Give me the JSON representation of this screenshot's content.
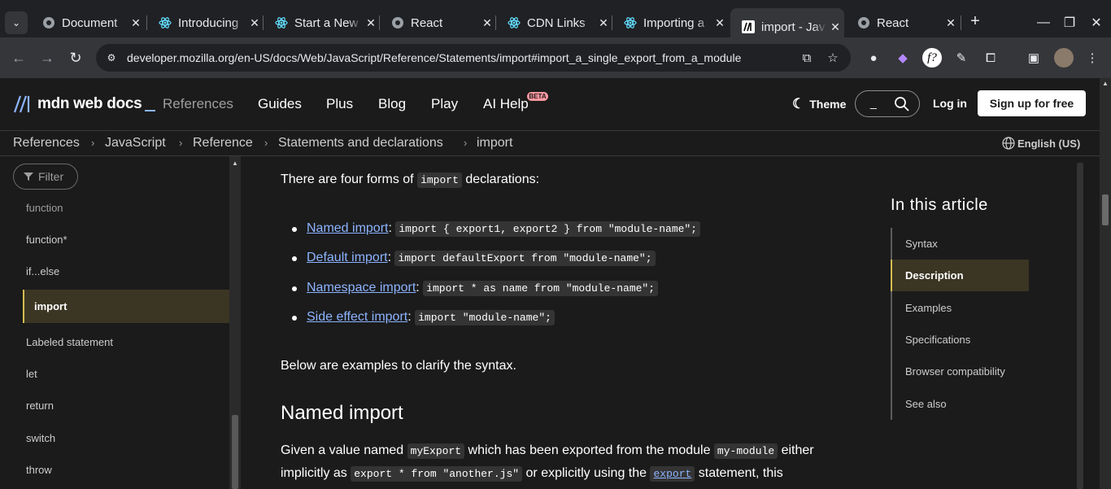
{
  "browser": {
    "tabs": [
      {
        "label": "Document",
        "icon": "globe-icon"
      },
      {
        "label": "Introducing",
        "icon": "react-icon"
      },
      {
        "label": "Start a New",
        "icon": "react-icon"
      },
      {
        "label": "React",
        "icon": "globe-icon"
      },
      {
        "label": "CDN Links",
        "icon": "react-icon"
      },
      {
        "label": "Importing a",
        "icon": "react-icon"
      },
      {
        "label": "import - Jav",
        "icon": "mdn-icon",
        "active": true
      },
      {
        "label": "React",
        "icon": "globe-icon"
      }
    ],
    "url": "developer.mozilla.org/en-US/docs/Web/JavaScript/Reference/Statements/import#import_a_single_export_from_a_module"
  },
  "header": {
    "logo_text": "mdn web docs",
    "nav": [
      "References",
      "Guides",
      "Plus",
      "Blog",
      "Play",
      "AI Help"
    ],
    "beta": "BETA",
    "theme": "Theme",
    "login": "Log in",
    "signup": "Sign up for free"
  },
  "breadcrumb": {
    "items": [
      "References",
      "JavaScript",
      "Reference",
      "Statements and declarations",
      "import"
    ],
    "language": "English (US)"
  },
  "sidebar": {
    "filter_placeholder": "Filter",
    "items": [
      "function",
      "function*",
      "if...else",
      "import",
      "Labeled statement",
      "let",
      "return",
      "switch",
      "throw"
    ],
    "active": "import"
  },
  "article": {
    "intro_pre": "There are four forms of ",
    "intro_code": "import",
    "intro_post": " declarations:",
    "forms": [
      {
        "link": "Named import",
        "sep": ": ",
        "code": "import { export1, export2 } from \"module-name\";"
      },
      {
        "link": "Default import",
        "sep": ": ",
        "code": "import defaultExport from \"module-name\";"
      },
      {
        "link": "Namespace import",
        "sep": ": ",
        "code": "import * as name from \"module-name\";"
      },
      {
        "link": "Side effect import",
        "sep": ": ",
        "code": "import \"module-name\";"
      }
    ],
    "below": "Below are examples to clarify the syntax.",
    "h2": "Named import",
    "para1_a": "Given a value named ",
    "para1_code1": "myExport",
    "para1_b": " which has been exported from the module ",
    "para1_code2": "my-module",
    "para1_c": " either",
    "para2_a": "implicitly as ",
    "para2_code1": "export * from \"another.js\"",
    "para2_b": " or explicitly using the ",
    "para2_link": "export",
    "para2_c": " statement, this"
  },
  "toc": {
    "title": "In this article",
    "items": [
      "Syntax",
      "Description",
      "Examples",
      "Specifications",
      "Browser compatibility",
      "See also"
    ],
    "active": "Description"
  },
  "colors": {
    "accent_link": "#8cb4ff",
    "active_bg": "#3b3523",
    "active_border": "#d4bc51"
  }
}
